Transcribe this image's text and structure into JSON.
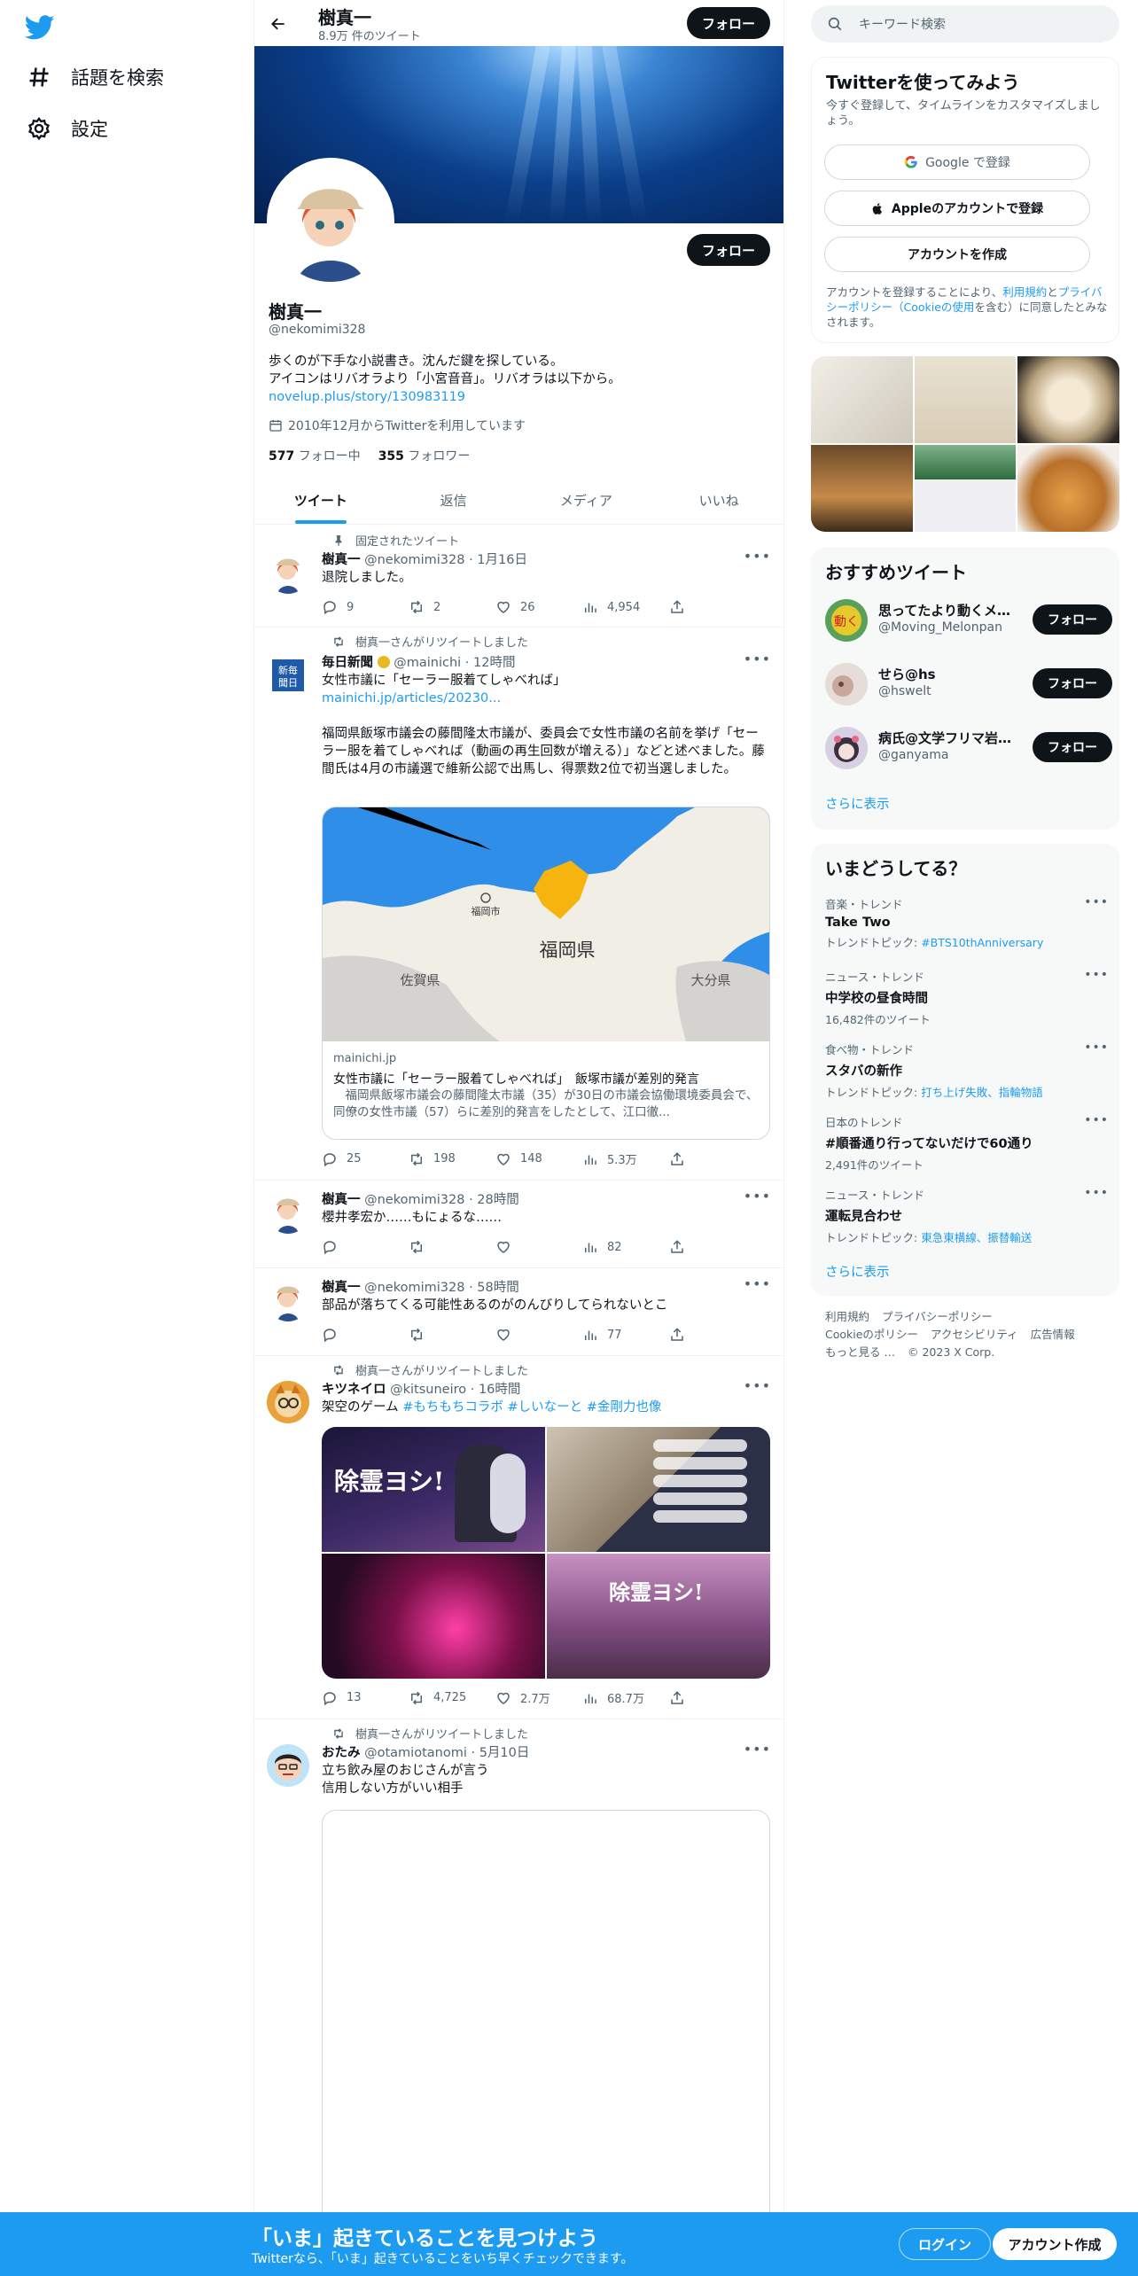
{
  "nav": {
    "explore_label": "話題を検索",
    "settings_label": "設定"
  },
  "header": {
    "title": "樹真一",
    "tweet_count": "8.9万 件のツイート",
    "follow_label": "フォロー"
  },
  "profile": {
    "name": "樹真一",
    "handle": "@nekomimi328",
    "follow_label": "フォロー",
    "bio_line1": "歩くのが下手な小説書き。沈んだ鍵を探している。",
    "bio_line2": "アイコンはリバオラより「小宮音音」。リバオラは以下から。",
    "bio_link": "novelup.plus/story/130983119",
    "joined": "2010年12月からTwitterを利用しています",
    "following_count": "577",
    "following_label": "フォロー中",
    "followers_count": "355",
    "followers_label": "フォロワー"
  },
  "tabs": [
    "ツイート",
    "返信",
    "メディア",
    "いいね"
  ],
  "tweets": [
    {
      "context": "固定されたツイート",
      "name": "樹真一",
      "meta": "@nekomimi328 · 1月16日",
      "text": "退院しました。",
      "reply": "9",
      "retweet": "2",
      "like": "26",
      "views": "4,954"
    },
    {
      "context": "樹真一さんがリツイートしました",
      "name": "毎日新聞",
      "meta": "@mainichi · 12時間",
      "text1": "女性市議に「セーラー服着てしゃべれば」",
      "link": "mainichi.jp/articles/20230...",
      "text2": "福岡県飯塚市議会の藤間隆太市議が、委員会で女性市議の名前を挙げ「セーラー服を着てしゃべれば（動画の再生回数が増える）」などと述べました。藤間氏は4月の市議選で維新公認で出馬し、得票数2位で初当選しました。",
      "card_domain": "mainichi.jp",
      "card_title": "女性市議に「セーラー服着てしゃべれば」　飯塚市議が差別的発言",
      "card_desc": "　福岡県飯塚市議会の藤間隆太市議（35）が30日の市議会協働環境委員会で、同僚の女性市議（57）らに差別的発言をしたとして、江口徹...",
      "map_labels": {
        "city": "福岡市",
        "pref": "福岡県",
        "saga": "佐賀県",
        "oita": "大分県"
      },
      "reply": "25",
      "retweet": "198",
      "like": "148",
      "views": "5.3万"
    },
    {
      "name": "樹真一",
      "meta": "@nekomimi328 · 28時間",
      "text": "櫻井孝宏か……もにょるな……",
      "reply": "",
      "retweet": "",
      "like": "",
      "views": "82"
    },
    {
      "name": "樹真一",
      "meta": "@nekomimi328 · 58時間",
      "text": "部品が落ちてくる可能性あるのがのんびりしてられないとこ",
      "reply": "",
      "retweet": "",
      "like": "",
      "views": "77"
    },
    {
      "context": "樹真一さんがリツイートしました",
      "name": "キツネイロ",
      "meta": "@kitsuneiro · 16時間",
      "text_plain": "架空のゲーム",
      "hashtags": "#もちもちコラボ #しいなーと #金剛力也像",
      "game_logo": "除霊ヨシ!",
      "reply": "13",
      "retweet": "4,725",
      "like": "2.7万",
      "views": "68.7万"
    },
    {
      "context": "樹真一さんがリツイートしました",
      "name": "おたみ",
      "meta": "@otamiotanomi · 5月10日",
      "text1": "立ち飲み屋のおじさんが言う",
      "text2": "信用しない方がいい相手"
    }
  ],
  "right": {
    "search_placeholder": "キーワード検索",
    "signup_title": "Twitterを使ってみよう",
    "signup_sub": "今すぐ登録して、タイムラインをカスタマイズしましょう。",
    "google_btn": "Google で登録",
    "apple_btn": "Appleのアカウントで登録",
    "create_btn": "アカウントを作成",
    "terms_pre": "アカウントを登録することにより、",
    "terms_link1": "利用規約",
    "terms_mid": "と",
    "terms_link2": "プライバシーポリシー（Cookieの使用",
    "terms_post": "を含む）に同意したとみなされます。",
    "rec_title": "おすすめツイート",
    "recs": [
      {
        "name": "思ってたより動くメ…",
        "handle": "@Moving_Melonpan",
        "follow": "フォロー"
      },
      {
        "name": "せら@hs",
        "handle": "@hswelt",
        "follow": "フォロー"
      },
      {
        "name": "病氏@文学フリマ岩…",
        "handle": "@ganyama",
        "follow": "フォロー"
      }
    ],
    "rec_more": "さらに表示",
    "trends_title": "いまどうしてる？",
    "trends": [
      {
        "cat": "音楽・トレンド",
        "name": "Take Two",
        "extra_pre": "トレンドトピック: ",
        "extra_link": "#BTS10thAnniversary"
      },
      {
        "cat": "ニュース・トレンド",
        "name": "中学校の昼食時間",
        "extra_pre": "16,482件のツイート",
        "extra_link": ""
      },
      {
        "cat": "食べ物・トレンド",
        "name": "スタバの新作",
        "extra_pre": "トレンドトピック: ",
        "extra_link": "打ち上げ失敗、指輪物語"
      },
      {
        "cat": "日本のトレンド",
        "name": "#順番通り行ってないだけで60通り",
        "extra_pre": "2,491件のツイート",
        "extra_link": ""
      },
      {
        "cat": "ニュース・トレンド",
        "name": "運転見合わせ",
        "extra_pre": "トレンドトピック: ",
        "extra_link": "東急東横線、振替輸送"
      }
    ],
    "trends_more": "さらに表示",
    "footer": [
      "利用規約",
      "プライバシーポリシー",
      "Cookieのポリシー",
      "アクセシビリティ",
      "広告情報",
      "もっと見る …",
      "© 2023 X Corp."
    ]
  },
  "bottombar": {
    "title": "「いま」起きていることを見つけよう",
    "sub": "Twitterなら、「いま」起きていることをいち早くチェックできます。",
    "login": "ログイン",
    "create": "アカウント作成"
  }
}
